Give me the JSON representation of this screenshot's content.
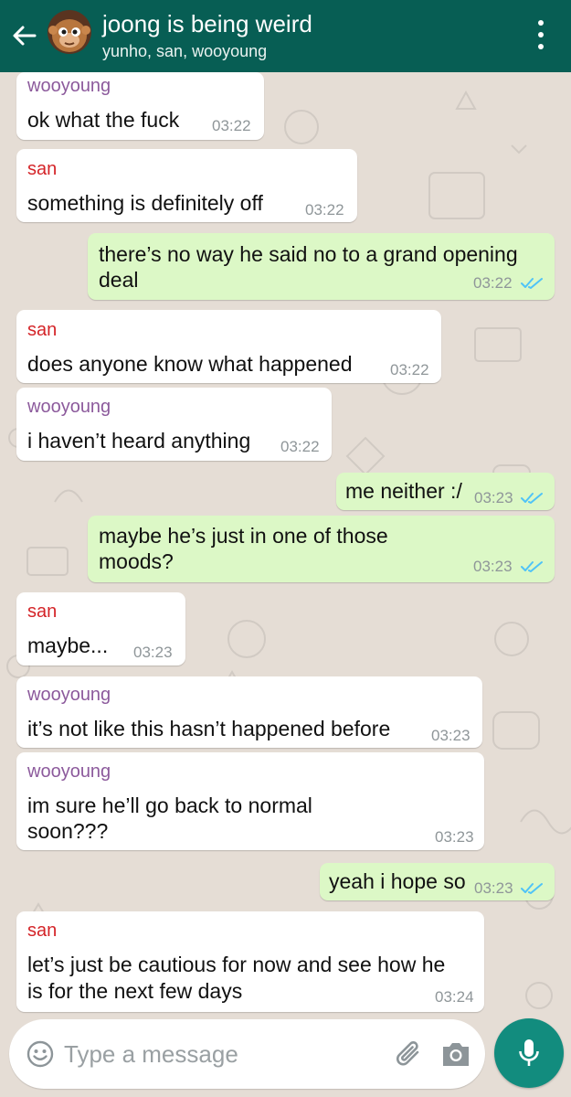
{
  "header": {
    "title": "joong is being weird",
    "subtitle": "yunho, san, wooyoung",
    "colors": {
      "bar": "#075e54"
    }
  },
  "messages": [
    {
      "direction": "incoming",
      "sender": "wooyoung",
      "lines": [
        "ok what the fuck"
      ],
      "time": "03:22"
    },
    {
      "direction": "incoming",
      "sender": "san",
      "lines": [
        "something is definitely off"
      ],
      "time": "03:22"
    },
    {
      "direction": "outgoing",
      "lines": [
        "there’s no way he said no to a grand opening",
        "deal"
      ],
      "time": "03:22",
      "status": "read"
    },
    {
      "direction": "incoming",
      "sender": "san",
      "lines": [
        "does anyone know what happened"
      ],
      "time": "03:22"
    },
    {
      "direction": "incoming",
      "sender": "wooyoung",
      "lines": [
        "i haven’t heard anything"
      ],
      "time": "03:22"
    },
    {
      "direction": "outgoing",
      "lines": [
        "me neither :/"
      ],
      "time": "03:23",
      "status": "read"
    },
    {
      "direction": "outgoing",
      "lines": [
        "maybe he’s just in one of those",
        "moods?"
      ],
      "time": "03:23",
      "status": "read"
    },
    {
      "direction": "incoming",
      "sender": "san",
      "lines": [
        "maybe..."
      ],
      "time": "03:23"
    },
    {
      "direction": "incoming",
      "sender": "wooyoung",
      "lines": [
        "it’s not like this hasn’t happened before"
      ],
      "time": "03:23"
    },
    {
      "direction": "incoming",
      "sender": "wooyoung",
      "lines": [
        "im sure he’ll go back to normal",
        "soon???"
      ],
      "time": "03:23"
    },
    {
      "direction": "outgoing",
      "lines": [
        "yeah i hope so"
      ],
      "time": "03:23",
      "status": "read"
    },
    {
      "direction": "incoming",
      "sender": "san",
      "lines": [
        "let’s just be cautious for now and see how he",
        "is for the next few days"
      ],
      "time": "03:24"
    }
  ],
  "composer": {
    "placeholder": "Type a message"
  },
  "icons": {
    "back": "arrow-left-icon",
    "menu": "more-vertical-icon",
    "emoji": "smiley-icon",
    "attach": "paperclip-icon",
    "camera": "camera-icon",
    "mic": "microphone-icon",
    "read_receipt": "double-check-icon"
  },
  "colors": {
    "accent": "#128c7e",
    "incoming_bubble": "#ffffff",
    "outgoing_bubble": "#dcf8c6",
    "read_ticks": "#4fc3f7",
    "sender_wooyoung": "#8c5a9c",
    "sender_san": "#d42428"
  }
}
